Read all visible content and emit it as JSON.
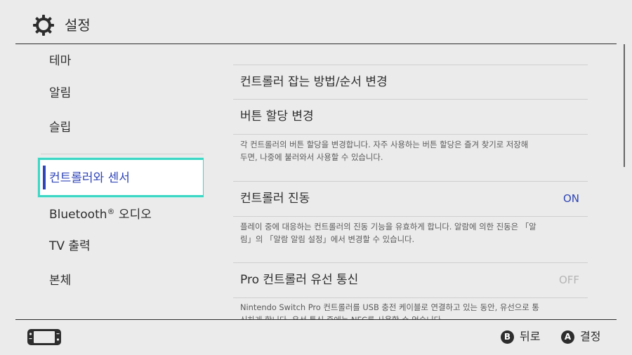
{
  "header": {
    "title": "설정",
    "icon": "gear-icon"
  },
  "sidebar": {
    "items": [
      {
        "label": "테마"
      },
      {
        "label": "알림"
      },
      {
        "label": "슬립"
      },
      {
        "label": "컨트롤러와 센서",
        "selected": true
      },
      {
        "label": "Bluetooth",
        "sup": "®",
        "suffix": " 오디오"
      },
      {
        "label": "TV 출력"
      },
      {
        "label": "본체"
      }
    ]
  },
  "main": {
    "rows": [
      {
        "label": "컨트롤러 잡는 방법/순서 변경"
      },
      {
        "label": "버튼 할당 변경"
      },
      {
        "label": "컨트롤러 진동",
        "value": "ON"
      },
      {
        "label": "Pro 컨트롤러 유선 통신",
        "value": "OFF"
      }
    ],
    "descriptions": {
      "button_assign_1": "각 컨트롤러의 버튼 할당을 변경합니다. 자주 사용하는 버튼 할당은 즐겨 찾기로 저장해",
      "button_assign_2": "두면, 나중에 불러와서 사용할 수 있습니다.",
      "vibration_1": "플레이 중에 대응하는 컨트롤러의 진동 기능을 유효하게 합니다. 알람에 의한 진동은 「알",
      "vibration_2": "림」의 「알람 알림 설정」에서 변경할 수 있습니다.",
      "pro_wired_1": "Nintendo Switch Pro 컨트롤러를 USB 충전 케이블로 연결하고 있는 동안, 유선으로 통",
      "pro_wired_2": "신하게 합니다. 유선 통신 중에는 NFC를 사용할 수 없습니다."
    }
  },
  "footer": {
    "back": {
      "button": "B",
      "label": "뒤로"
    },
    "confirm": {
      "button": "A",
      "label": "결정"
    }
  },
  "colors": {
    "accent": "#2f45b8",
    "highlight_border": "#3ed7c5",
    "background": "#ebebeb"
  }
}
